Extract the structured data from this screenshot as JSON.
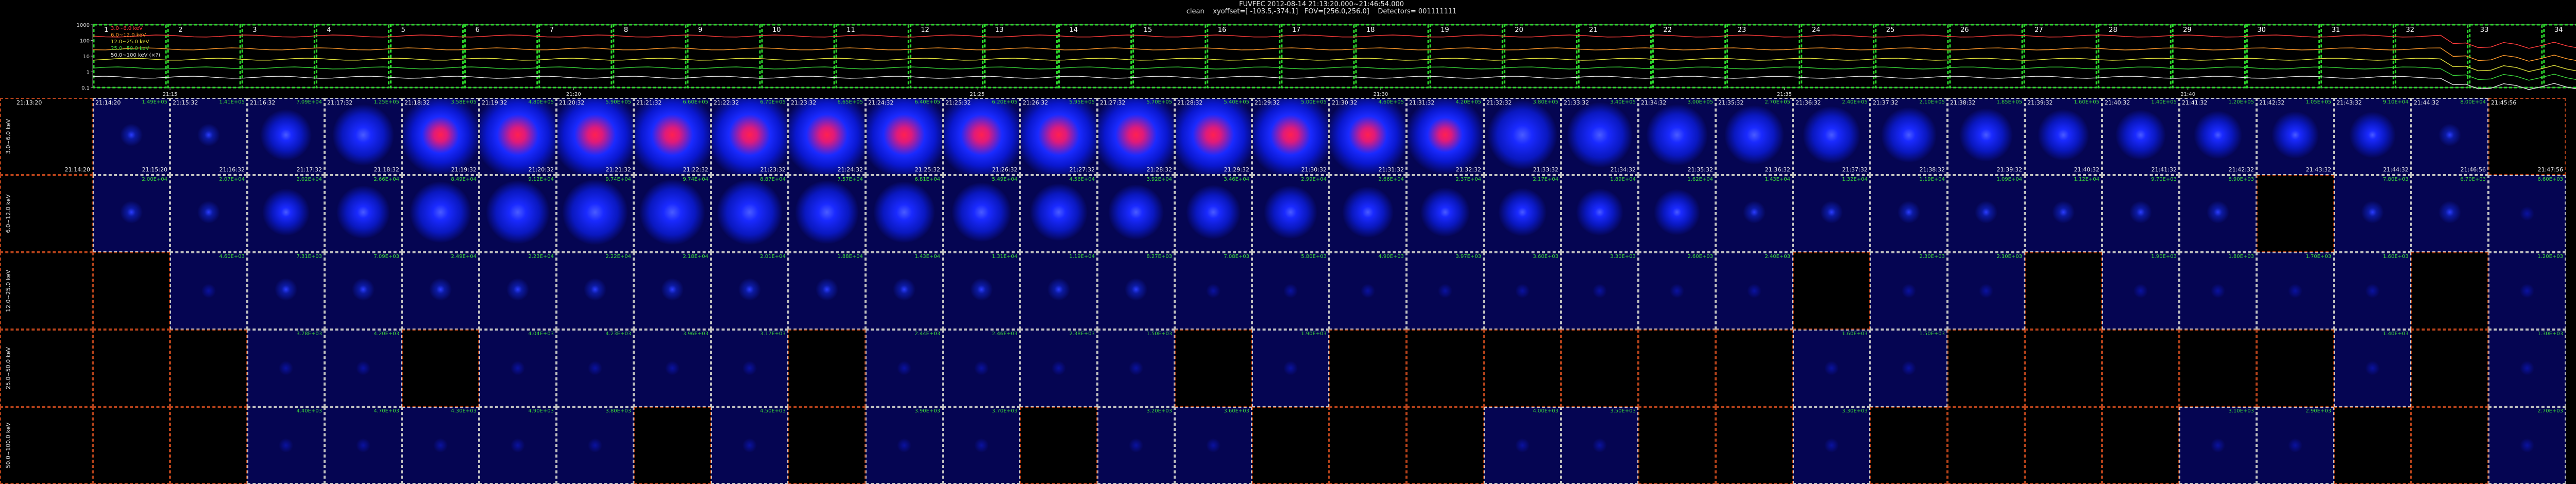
{
  "header": {
    "line1": "FUVFEC 2012-08-14 21:13:20.000~21:46:54.000",
    "line2": "clean    xyoffset=[ -103.5,-374.1]   FOV=[256.0,256.0]    Detectors= 001111111"
  },
  "lightcurve": {
    "legend": [
      {
        "label": "3.0~6.0 keV",
        "color": "#ff3b3b"
      },
      {
        "label": "6.0~12.0 keV",
        "color": "#ff9a2a"
      },
      {
        "label": "12.0~25.0 keV",
        "color": "#e0e03a"
      },
      {
        "label": "25.0~50.0 keV",
        "color": "#3ad33a"
      },
      {
        "label": "50.0~100 keV (×?)",
        "color": "#e0e0e0"
      }
    ],
    "y_ticks": [
      "1000",
      "100",
      "10",
      "1",
      "0.1"
    ],
    "x_ticks": [
      "21:15",
      "21:20",
      "21:25",
      "21:30",
      "21:35",
      "21:40",
      "21:45"
    ],
    "interval_labels": [
      "1",
      "2",
      "3",
      "4",
      "5",
      "6",
      "7",
      "8",
      "9",
      "10",
      "11",
      "12",
      "13",
      "14",
      "15",
      "16",
      "17",
      "18",
      "19",
      "20",
      "21",
      "22",
      "23",
      "24",
      "25",
      "26",
      "27",
      "28",
      "29",
      "30",
      "31",
      "32",
      "33",
      "34"
    ]
  },
  "bands": [
    {
      "label": "3.0~6.0 keV"
    },
    {
      "label": "6.0~12.0 keV"
    },
    {
      "label": "12.0~25.0 keV"
    },
    {
      "label": "25.0~50.0 keV"
    },
    {
      "label": "50.0~100.0 keV"
    }
  ],
  "start_times": [
    "21:14:20",
    "21:15:32",
    "21:16:32",
    "21:17:32",
    "21:18:32",
    "21:19:32",
    "21:20:32",
    "21:21:32",
    "21:22:32",
    "21:23:32",
    "21:24:32",
    "21:25:32",
    "21:26:32",
    "21:27:32",
    "21:28:32",
    "21:29:32",
    "21:30:32",
    "21:31:32",
    "21:32:32",
    "21:33:32",
    "21:34:32",
    "21:35:32",
    "21:36:32",
    "21:37:32",
    "21:38:32",
    "21:39:32",
    "21:40:32",
    "21:41:32",
    "21:42:32",
    "21:43:32",
    "21:44:32",
    "21:45:56"
  ],
  "end_times": [
    "21:15:20",
    "21:16:32",
    "21:17:32",
    "21:18:32",
    "21:19:32",
    "21:20:32",
    "21:21:32",
    "21:22:32",
    "21:23:32",
    "21:24:32",
    "21:25:32",
    "21:26:32",
    "21:27:32",
    "21:28:32",
    "21:29:32",
    "21:30:32",
    "21:31:32",
    "21:32:32",
    "21:33:32",
    "21:34:32",
    "21:35:32",
    "21:36:32",
    "21:37:32",
    "21:38:32",
    "21:39:32",
    "21:40:32",
    "21:41:32",
    "21:42:32",
    "21:43:32",
    "21:44:32",
    "21:46:56",
    "21:47:56"
  ],
  "top_left_panel": {
    "time_start": "21:13:20",
    "time_end": "21:14:20"
  },
  "rows": [
    {
      "state": [
        "img",
        "img",
        "img",
        "img",
        "img",
        "img",
        "img",
        "img",
        "img",
        "img",
        "img",
        "img",
        "img",
        "img",
        "img",
        "img",
        "img",
        "img",
        "img",
        "img",
        "img",
        "img",
        "img",
        "img",
        "img",
        "img",
        "img",
        "img",
        "img",
        "img",
        "img",
        "empty"
      ],
      "intensity": [
        0.05,
        0.1,
        0.25,
        0.5,
        0.85,
        1,
        1,
        1,
        1,
        1,
        1,
        1,
        1,
        1,
        1,
        0.95,
        0.9,
        0.8,
        0.7,
        0.6,
        0.5,
        0.45,
        0.4,
        0.35,
        0.3,
        0.25,
        0.22,
        0.18,
        0.15,
        0.12,
        0.1,
        0
      ],
      "levels": [
        "1.49E+05",
        "1.41E+05",
        "7.09E+04",
        "1.25E+05",
        "3.58E+05",
        "4.80E+05",
        "5.90E+05",
        "6.60E+05",
        "6.70E+05",
        "6.65E+05",
        "6.40E+05",
        "6.20E+05",
        "5.95E+05",
        "5.70E+05",
        "5.40E+05",
        "5.00E+05",
        "4.60E+05",
        "4.20E+05",
        "3.80E+05",
        "3.40E+05",
        "3.00E+05",
        "2.70E+05",
        "2.40E+05",
        "2.10E+05",
        "1.85E+05",
        "1.60E+05",
        "1.40E+05",
        "1.20E+05",
        "1.05E+05",
        "9.10E+04",
        "8.00E+04",
        ""
      ]
    },
    {
      "state": [
        "img",
        "img",
        "img",
        "img",
        "img",
        "img",
        "img",
        "img",
        "img",
        "img",
        "img",
        "img",
        "img",
        "img",
        "img",
        "img",
        "img",
        "img",
        "img",
        "img",
        "img",
        "img",
        "img",
        "img",
        "img",
        "img",
        "img",
        "img",
        "empty",
        "img",
        "img",
        "img"
      ],
      "intensity": [
        0.05,
        0.08,
        0.15,
        0.3,
        0.5,
        0.55,
        0.6,
        0.6,
        0.6,
        0.55,
        0.5,
        0.45,
        0.4,
        0.35,
        0.32,
        0.3,
        0.25,
        0.2,
        0.18,
        0.15,
        0.12,
        0.1,
        0.08,
        0.07,
        0.06,
        0.05,
        0.05,
        0.04,
        0,
        0.03,
        0.03,
        0.02
      ],
      "levels": [
        "2.00E+04",
        "2.07E+04",
        "2.02E+04",
        "2.66E+04",
        "8.49E+04",
        "9.12E+04",
        "9.74E+04",
        "9.74E+04",
        "8.87E+04",
        "7.57E+04",
        "6.81E+04",
        "5.49E+04",
        "4.56E+04",
        "3.92E+04",
        "3.46E+04",
        "2.99E+04",
        "2.66E+04",
        "2.37E+04",
        "2.17E+04",
        "1.89E+04",
        "1.62E+04",
        "1.43E+04",
        "1.32E+04",
        "1.19E+04",
        "1.09E+04",
        "1.12E+04",
        "9.70E+03",
        "8.90E+03",
        "",
        "7.80E+03",
        "6.70E+03",
        "6.60E+03"
      ]
    },
    {
      "state": [
        "empty",
        "img",
        "img",
        "img",
        "img",
        "img",
        "img",
        "img",
        "img",
        "img",
        "img",
        "img",
        "img",
        "img",
        "img",
        "img",
        "img",
        "img",
        "img",
        "img",
        "img",
        "img",
        "empty",
        "img",
        "img",
        "empty",
        "img",
        "img",
        "img",
        "img",
        "empty",
        "img"
      ],
      "intensity": [
        0,
        0.02,
        0.03,
        0.03,
        0.04,
        0.04,
        0.04,
        0.04,
        0.04,
        0.03,
        0.03,
        0.03,
        0.03,
        0.03,
        0.02,
        0.02,
        0.02,
        0.02,
        0.02,
        0.02,
        0.01,
        0.01,
        0,
        0.01,
        0.01,
        0,
        0.01,
        0.01,
        0.01,
        0.01,
        0,
        0.01
      ],
      "levels": [
        "",
        "4.60E+03",
        "7.31E+03",
        "7.09E+03",
        "2.49E+04",
        "2.23E+04",
        "2.22E+04",
        "2.18E+04",
        "2.01E+04",
        "1.88E+04",
        "1.43E+04",
        "1.31E+04",
        "1.19E+04",
        "8.27E+03",
        "7.08E+03",
        "5.80E+03",
        "4.90E+03",
        "3.97E+03",
        "3.60E+03",
        "3.30E+03",
        "2.60E+03",
        "2.40E+03",
        "",
        "2.30E+03",
        "2.10E+03",
        "",
        "1.90E+03",
        "1.80E+03",
        "1.70E+03",
        "1.60E+03",
        "",
        "1.20E+03"
      ]
    },
    {
      "state": [
        "empty",
        "empty",
        "img",
        "img",
        "empty",
        "img",
        "img",
        "img",
        "img",
        "empty",
        "img",
        "img",
        "img",
        "img",
        "empty",
        "img",
        "empty",
        "empty",
        "empty",
        "empty",
        "empty",
        "empty",
        "img",
        "img",
        "empty",
        "empty",
        "empty",
        "empty",
        "empty",
        "img",
        "empty",
        "img"
      ],
      "intensity": [
        0,
        0,
        0.01,
        0.01,
        0,
        0.01,
        0.01,
        0.01,
        0.01,
        0,
        0.01,
        0.01,
        0.01,
        0.01,
        0,
        0.01,
        0,
        0,
        0,
        0,
        0,
        0,
        0.01,
        0.01,
        0,
        0,
        0,
        0,
        0,
        0.01,
        0,
        0.01
      ],
      "levels": [
        "",
        "",
        "3.78E+03",
        "4.20E+03",
        "",
        "4.04E+03",
        "4.23E+03",
        "3.96E+03",
        "3.17E+03",
        "",
        "2.44E+03",
        "2.46E+03",
        "2.38E+03",
        "1.50E+03",
        "",
        "1.90E+03",
        "",
        "",
        "",
        "",
        "",
        "",
        "1.60E+03",
        "1.50E+03",
        "",
        "",
        "",
        "",
        "",
        "1.40E+03",
        "",
        "1.30E+03"
      ]
    },
    {
      "state": [
        "empty",
        "empty",
        "img",
        "img",
        "img",
        "img",
        "img",
        "empty",
        "img",
        "empty",
        "img",
        "img",
        "empty",
        "img",
        "img",
        "empty",
        "empty",
        "empty",
        "img",
        "img",
        "empty",
        "empty",
        "img",
        "empty",
        "empty",
        "empty",
        "empty",
        "img",
        "img",
        "empty",
        "empty",
        "img"
      ],
      "intensity": [
        0,
        0,
        0.01,
        0.01,
        0.01,
        0.01,
        0.01,
        0,
        0.01,
        0,
        0.01,
        0.01,
        0,
        0.01,
        0.01,
        0,
        0,
        0,
        0.01,
        0.01,
        0,
        0,
        0.01,
        0,
        0,
        0,
        0,
        0.01,
        0.01,
        0,
        0,
        0.01
      ],
      "levels": [
        "",
        "",
        "4.40E+03",
        "4.70E+03",
        "4.30E+03",
        "4.90E+03",
        "3.80E+03",
        "",
        "4.50E+03",
        "",
        "3.90E+03",
        "3.70E+03",
        "",
        "3.20E+03",
        "3.60E+03",
        "",
        "",
        "",
        "4.00E+03",
        "3.50E+03",
        "",
        "",
        "3.30E+03",
        "",
        "",
        "",
        "",
        "3.10E+03",
        "2.90E+03",
        "",
        "",
        "2.70E+03"
      ]
    }
  ]
}
